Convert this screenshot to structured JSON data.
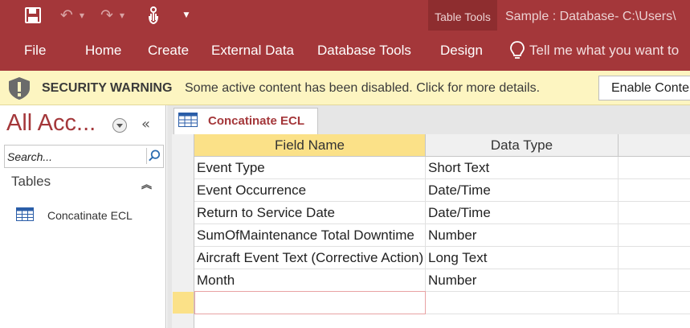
{
  "titlebar": {
    "context_tab_group": "Table Tools",
    "window_title": "Sample : Database- C:\\Users\\"
  },
  "ribbon": {
    "tabs": [
      "File",
      "Home",
      "Create",
      "External Data",
      "Database Tools",
      "Design"
    ],
    "active_tab": "Design",
    "tell_me": "Tell me what you want to"
  },
  "security_bar": {
    "title": "SECURITY WARNING",
    "message": "Some active content has been disabled. Click for more details.",
    "button": "Enable Content"
  },
  "nav_pane": {
    "title": "All Acc...",
    "search_placeholder": "Search...",
    "group": "Tables",
    "items": [
      {
        "label": "Concatinate ECL",
        "icon": "table-icon"
      }
    ]
  },
  "document": {
    "tab_label": "Concatinate ECL",
    "columns": {
      "field_name": "Field Name",
      "data_type": "Data Type"
    },
    "rows": [
      {
        "field": "Event Type",
        "type": "Short Text"
      },
      {
        "field": "Event Occurrence",
        "type": "Date/Time"
      },
      {
        "field": "Return to Service Date",
        "type": "Date/Time"
      },
      {
        "field": "SumOfMaintenance Total Downtime",
        "type": "Number"
      },
      {
        "field": "Aircraft Event Text (Corrective Action)",
        "type": "Long Text"
      },
      {
        "field": "Month",
        "type": "Number"
      }
    ]
  },
  "colors": {
    "brand": "#a4373a",
    "brand_dark": "#8e2d2f",
    "warning_bar": "#fdf5c1",
    "header_highlight": "#fbe188"
  }
}
